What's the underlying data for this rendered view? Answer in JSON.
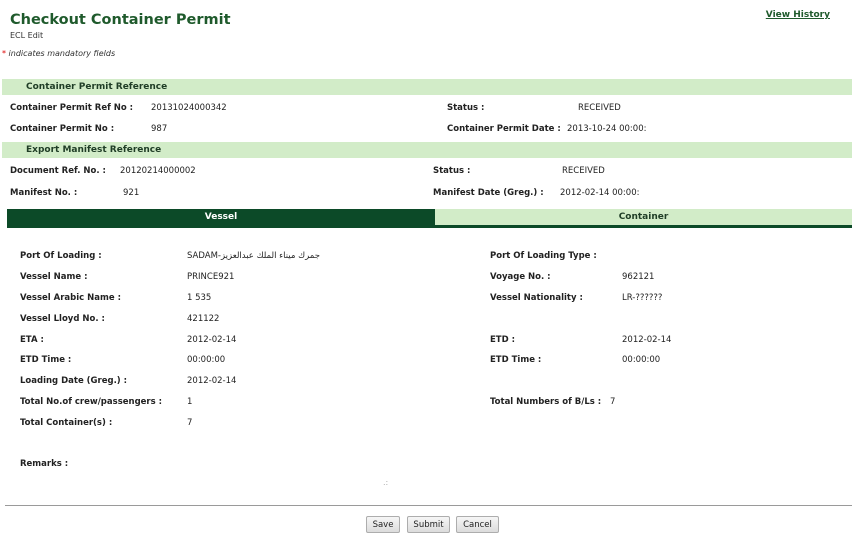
{
  "header": {
    "title": "Checkout Container Permit",
    "subtitle": "ECL Edit",
    "mandatory_note": "indicates mandatory fields",
    "mandatory_marker": "*",
    "view_history": "View History"
  },
  "permit_ref": {
    "heading": "Container Permit Reference",
    "ref_no_label": "Container Permit Ref No :",
    "ref_no_value": "20131024000342",
    "status_label": "Status :",
    "status_value": "RECEIVED",
    "permit_no_label": "Container Permit No :",
    "permit_no_value": "987",
    "permit_date_label": "Container Permit Date :",
    "permit_date_value": "2013-10-24 00:00:"
  },
  "manifest_ref": {
    "heading": "Export Manifest Reference",
    "doc_ref_label": "Document Ref. No. :",
    "doc_ref_value": "20120214000002",
    "status_label": "Status :",
    "status_value": "RECEIVED",
    "manifest_no_label": "Manifest No. :",
    "manifest_no_value": "921",
    "manifest_date_label": "Manifest Date (Greg.) :",
    "manifest_date_value": "2012-02-14 00:00:"
  },
  "tabs": {
    "vessel": "Vessel",
    "container": "Container"
  },
  "vessel": {
    "port_loading_label": "Port Of Loading :",
    "port_loading_value": "SADAM-جمرك ميناء الملك عبدالعزيز",
    "port_loading_type_label": "Port Of Loading Type :",
    "vessel_name_label": "Vessel Name :",
    "vessel_name_value": "PRINCE921",
    "voyage_label": "Voyage No. :",
    "voyage_value": "962121",
    "arabic_name_label": "Vessel Arabic Name :",
    "arabic_name_value": "1 535",
    "nationality_label": "Vessel Nationality :",
    "nationality_value": "LR-??????",
    "lloyd_label": "Vessel Lloyd No. :",
    "lloyd_value": "421122",
    "eta_label": "ETA :",
    "eta_value": "2012-02-14",
    "etd_label": "ETD :",
    "etd_value": "2012-02-14",
    "etd_time_label": "ETD Time :",
    "etd_time_value": "00:00:00",
    "etd_time2_label": "ETD Time :",
    "etd_time2_value": "00:00:00",
    "loading_date_label": "Loading Date (Greg.) :",
    "loading_date_value": "2012-02-14",
    "crew_label": "Total No.of crew/passengers :",
    "crew_value": "1",
    "bls_label": "Total Numbers of B/Ls :",
    "bls_value": "7",
    "containers_label": "Total Container(s) :",
    "containers_value": "7",
    "remarks_label": "Remarks :",
    "remarks_value": ""
  },
  "actions": {
    "save": "Save",
    "submit": "Submit",
    "cancel": "Cancel"
  }
}
